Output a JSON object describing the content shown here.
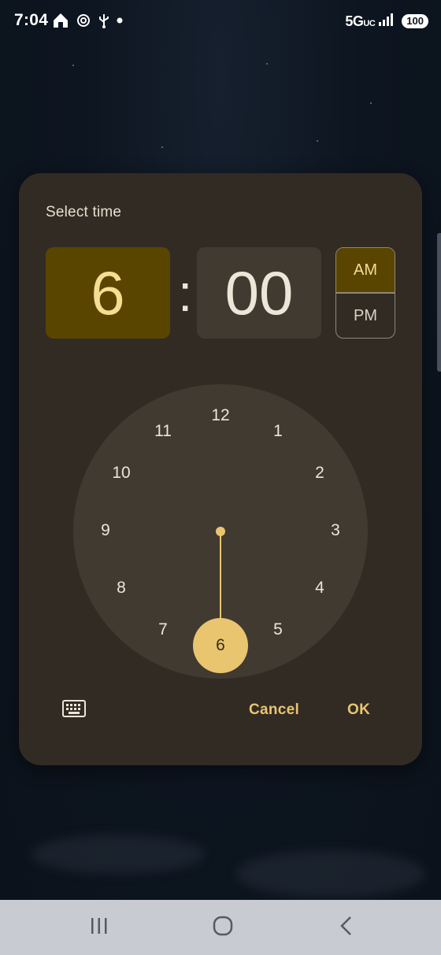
{
  "status_bar": {
    "time": "7:04",
    "network": "5G",
    "network_suffix": "UC",
    "battery": "100",
    "icons": [
      "home-icon",
      "openai-icon",
      "usb-icon",
      "dot-icon",
      "signal-icon"
    ]
  },
  "dialog": {
    "title": "Select time",
    "hour": "6",
    "separator": ":",
    "minute": "00",
    "am_label": "AM",
    "pm_label": "PM",
    "selected_period": "AM",
    "dial_numbers": [
      "12",
      "1",
      "2",
      "3",
      "4",
      "5",
      "6",
      "7",
      "8",
      "9",
      "10",
      "11"
    ],
    "selected_hour": "6",
    "cancel_label": "Cancel",
    "ok_label": "OK",
    "keyboard_icon": "keyboard-icon"
  },
  "nav_bar": {
    "icons": [
      "recents-icon",
      "home-circle-icon",
      "back-icon"
    ]
  },
  "colors": {
    "dialog_background": "#322b24",
    "accent": "#e9c56f",
    "selected_container": "#5a4500",
    "dial_background": "#403a31",
    "nav_bar": "#c8cbd1"
  }
}
